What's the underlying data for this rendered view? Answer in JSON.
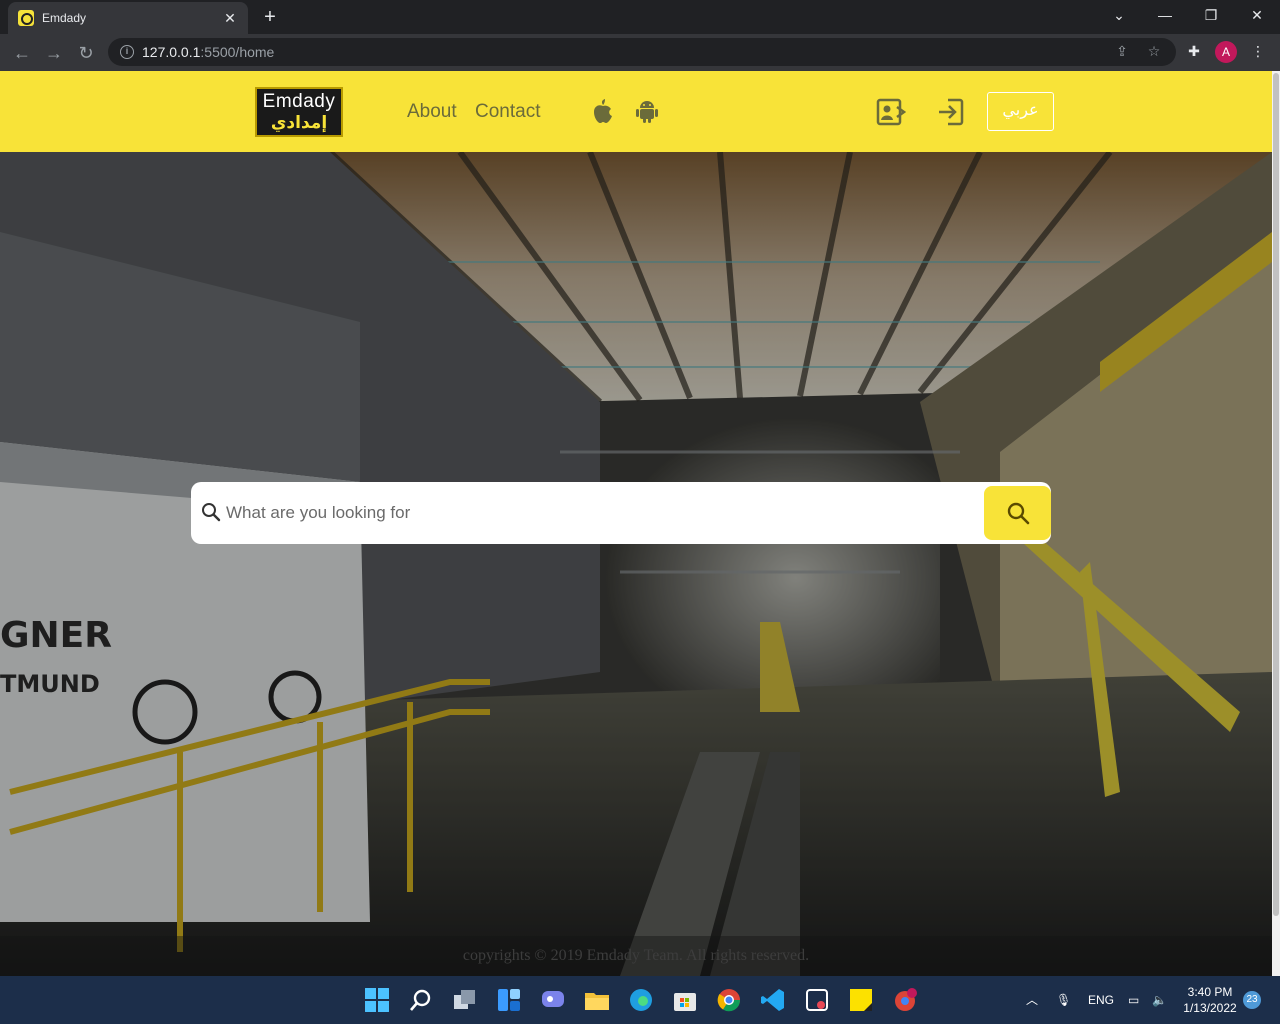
{
  "browser": {
    "tab_title": "Emdady",
    "url_host": "127.0.0.1",
    "url_path": ":5500/home",
    "profile_initial": "A"
  },
  "site": {
    "logo_en": "Emdady",
    "logo_ar": "إمدادي",
    "nav": {
      "about": "About",
      "contact": "Contact"
    },
    "lang_button": "عربي",
    "search_placeholder": "What are you looking for",
    "footer_text": "copyrights © 2019 Emdady Team.   All rights reserved."
  },
  "taskbar": {
    "language": "ENG",
    "time": "3:40 PM",
    "date": "1/13/2022",
    "notification_count": "23"
  },
  "colors": {
    "brand_yellow": "#f8e338",
    "taskbar": "#1c2e4a"
  }
}
